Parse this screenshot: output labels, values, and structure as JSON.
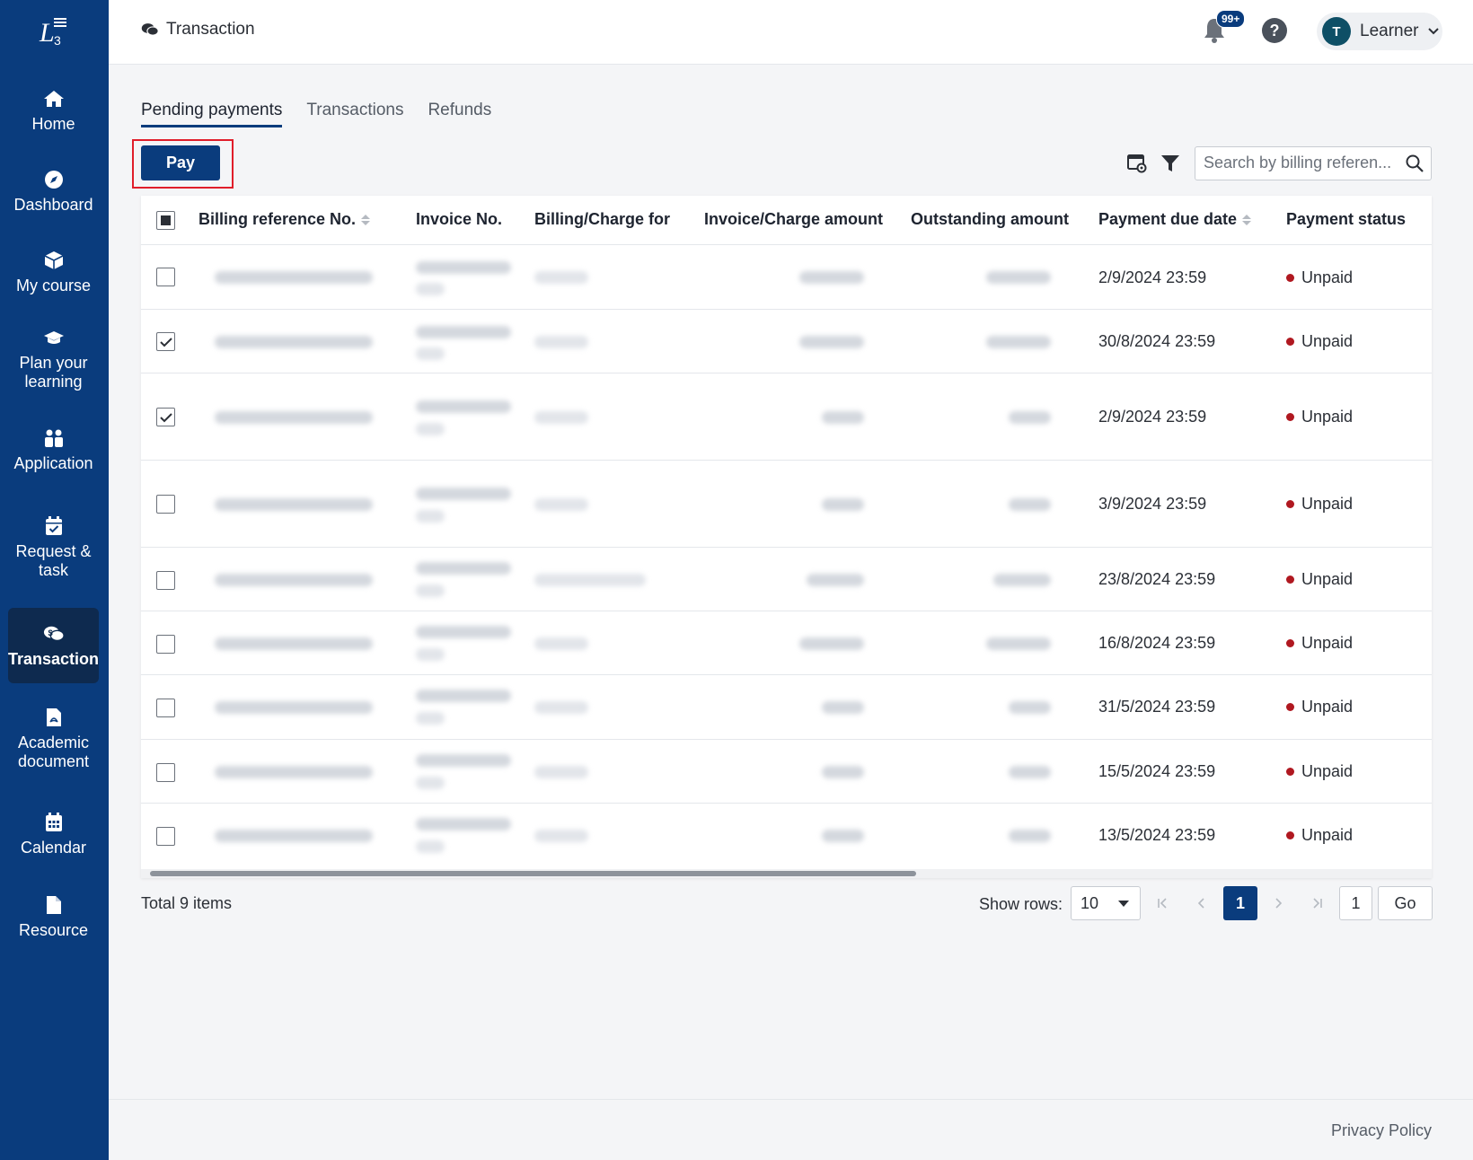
{
  "sidebar": {
    "items": [
      {
        "label": "Home",
        "icon": "home-icon"
      },
      {
        "label": "Dashboard",
        "icon": "compass-icon"
      },
      {
        "label": "My course",
        "icon": "cube-icon"
      },
      {
        "label": "Plan your learning",
        "icon": "graduation-cap-icon"
      },
      {
        "label": "Application",
        "icon": "users-icon"
      },
      {
        "label": "Request & task",
        "icon": "calendar-check-icon"
      },
      {
        "label": "Transaction",
        "icon": "dollar-chat-icon",
        "active": true
      },
      {
        "label": "Academic document",
        "icon": "pdf-file-icon"
      },
      {
        "label": "Calendar",
        "icon": "calendar-icon"
      },
      {
        "label": "Resource",
        "icon": "file-icon"
      }
    ]
  },
  "header": {
    "breadcrumb": "Transaction",
    "notification_badge": "99+",
    "user_initial": "T",
    "user_name": "Learner"
  },
  "tabs": [
    {
      "label": "Pending payments",
      "active": true
    },
    {
      "label": "Transactions"
    },
    {
      "label": "Refunds"
    }
  ],
  "toolbar": {
    "pay_label": "Pay",
    "search_placeholder": "Search by billing referen..."
  },
  "table": {
    "columns": [
      "Billing reference No.",
      "Invoice No.",
      "Billing/Charge for",
      "Invoice/Charge amount",
      "Outstanding amount",
      "Payment due date",
      "Payment status"
    ],
    "rows": [
      {
        "checked": false,
        "due": "2/9/2024 23:59",
        "status": "Unpaid"
      },
      {
        "checked": true,
        "due": "30/8/2024 23:59",
        "status": "Unpaid"
      },
      {
        "checked": true,
        "due": "2/9/2024 23:59",
        "status": "Unpaid"
      },
      {
        "checked": false,
        "due": "3/9/2024 23:59",
        "status": "Unpaid"
      },
      {
        "checked": false,
        "due": "23/8/2024 23:59",
        "status": "Unpaid"
      },
      {
        "checked": false,
        "due": "16/8/2024 23:59",
        "status": "Unpaid"
      },
      {
        "checked": false,
        "due": "31/5/2024 23:59",
        "status": "Unpaid"
      },
      {
        "checked": false,
        "due": "15/5/2024 23:59",
        "status": "Unpaid"
      },
      {
        "checked": false,
        "due": "13/5/2024 23:59",
        "status": "Unpaid"
      }
    ]
  },
  "pagination": {
    "total": "Total 9 items",
    "show_rows_label": "Show rows:",
    "rows_value": "10",
    "current_page": "1",
    "goto_value": "1",
    "go_label": "Go"
  },
  "footer": {
    "privacy": "Privacy Policy"
  },
  "colors": {
    "sidebar": "#0a3c7d",
    "active_nav": "#0e2a4f",
    "primary": "#0a3c7d",
    "unpaid_dot": "#b01820",
    "highlight": "#e01e2a"
  }
}
